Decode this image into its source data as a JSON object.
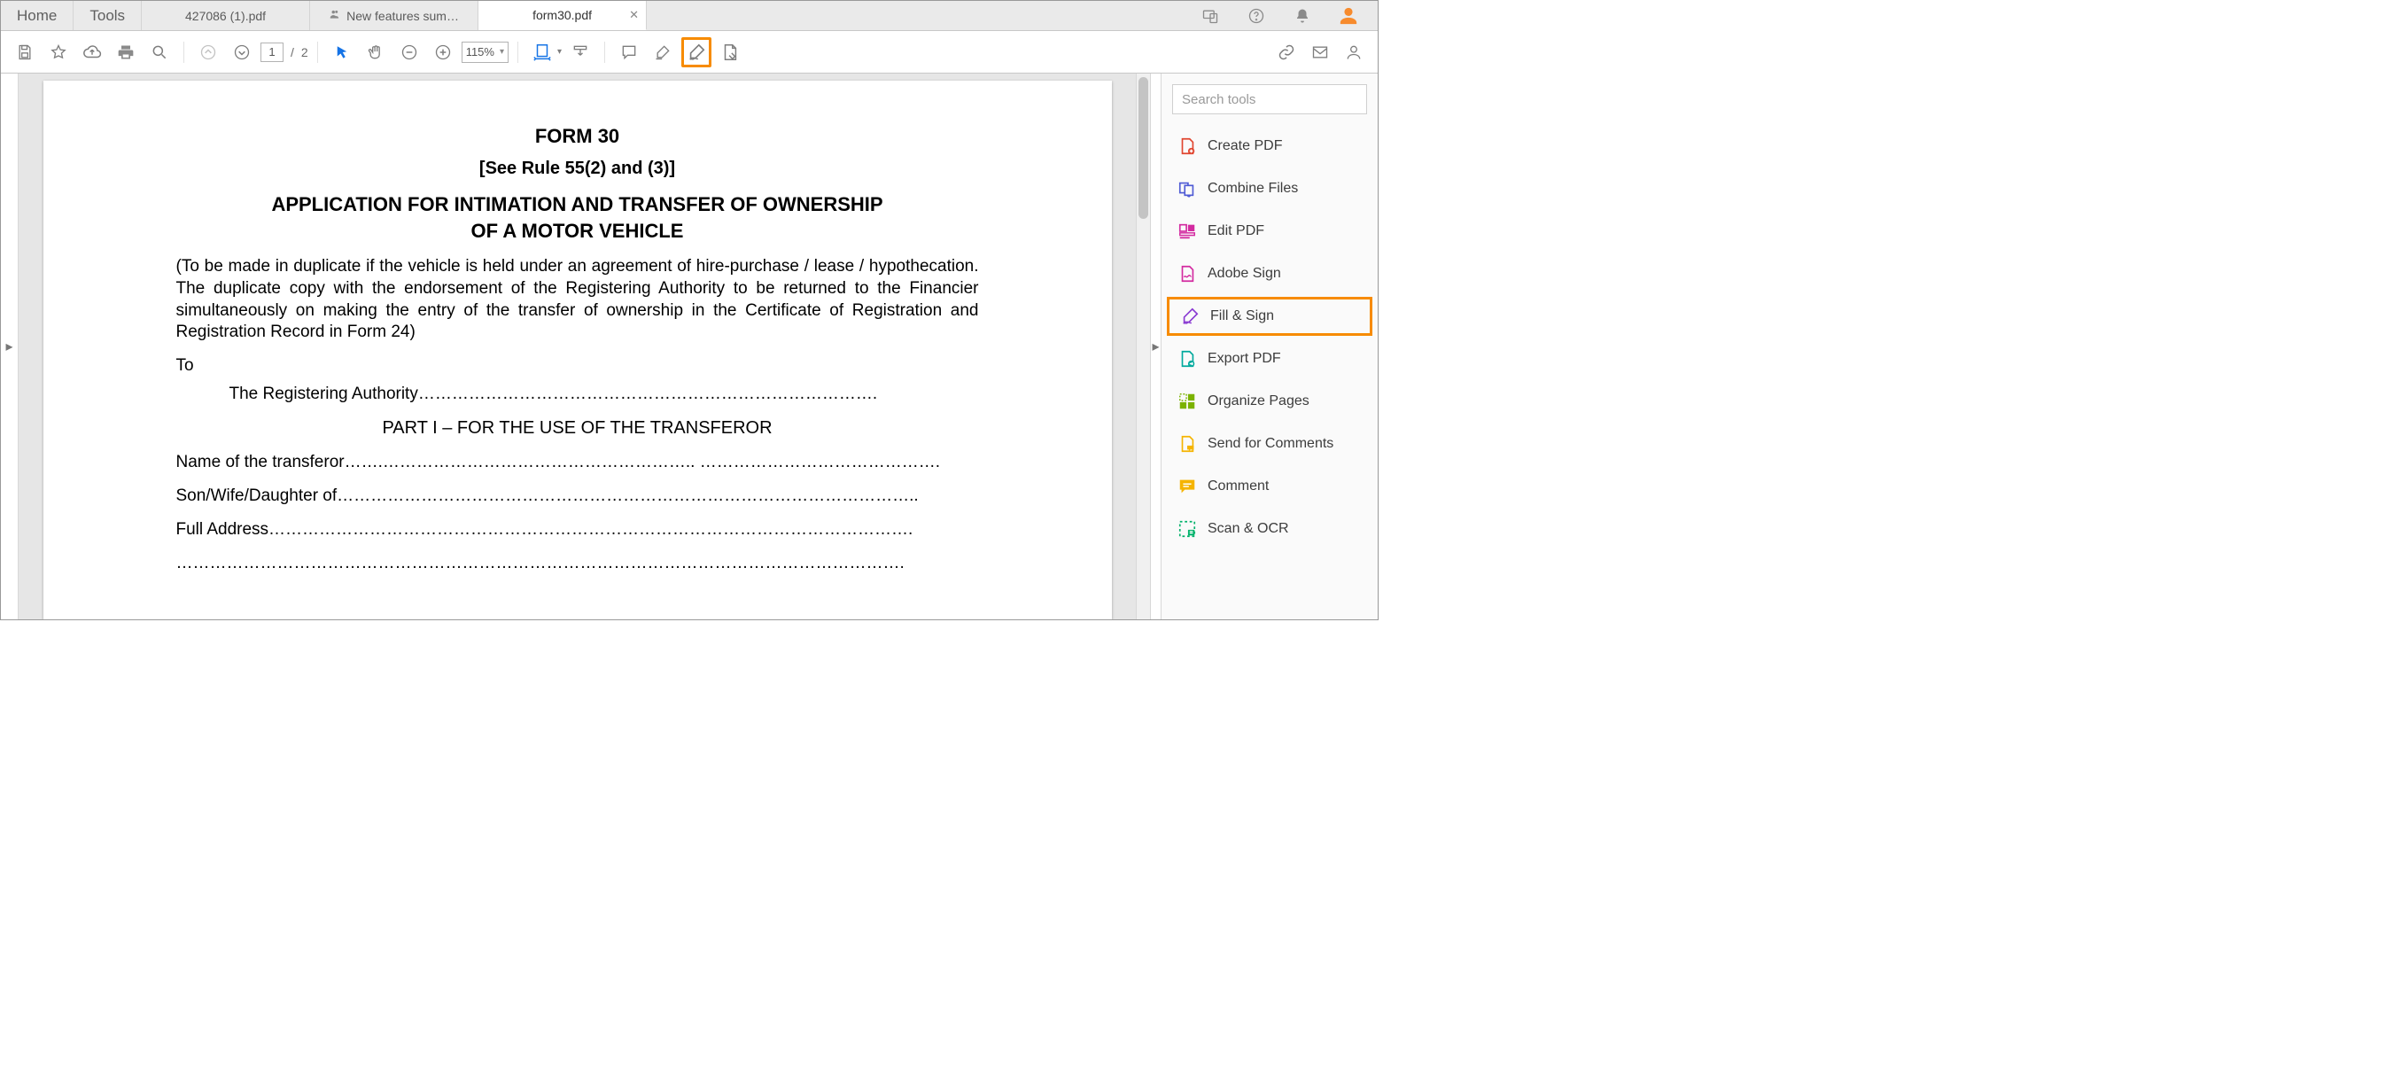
{
  "tabs": {
    "home": "Home",
    "tools": "Tools",
    "docs": [
      {
        "label": "427086 (1).pdf",
        "shared": false,
        "active": false
      },
      {
        "label": "New features sum…",
        "shared": true,
        "active": false
      },
      {
        "label": "form30.pdf",
        "shared": false,
        "active": true
      }
    ]
  },
  "toolbar": {
    "page_current": "1",
    "page_sep": "/",
    "page_total": "2",
    "zoom": "115%"
  },
  "document": {
    "title": "FORM 30",
    "subtitle": "[See Rule 55(2) and (3)]",
    "heading_l1": "APPLICATION FOR INTIMATION AND TRANSFER OF OWNERSHIP",
    "heading_l2": "OF A MOTOR VEHICLE",
    "note": "(To be made in duplicate if the vehicle is held under an agreement of hire-purchase / lease / hypothecation. The duplicate copy with the endorsement of the Registering Authority to be returned to the Financier simultaneously on making the entry of the transfer of ownership in the Certificate of Registration and Registration Record in Form 24)",
    "to": "To",
    "reg_auth": "The Registering Authority……………………………………………………………………….",
    "part": "PART I – FOR THE USE OF THE TRANSFEROR",
    "f1": "Name of the transferor…….……………………………………………….. …………………………………….",
    "f2": "Son/Wife/Daughter of…………………………………………………………………………………………..",
    "f3": "Full Address…………………………………………………………………………………………………….",
    "f4": "…………………………………………………………………………………………………………………."
  },
  "rpanel": {
    "search_placeholder": "Search tools",
    "tools": [
      {
        "label": "Create PDF",
        "color": "#e0452f"
      },
      {
        "label": "Combine Files",
        "color": "#4f5bd5"
      },
      {
        "label": "Edit PDF",
        "color": "#d32aa0"
      },
      {
        "label": "Adobe Sign",
        "color": "#d32aa0"
      },
      {
        "label": "Fill & Sign",
        "color": "#8a3bd2",
        "highlight": true
      },
      {
        "label": "Export PDF",
        "color": "#00a99d"
      },
      {
        "label": "Organize Pages",
        "color": "#7bb200"
      },
      {
        "label": "Send for Comments",
        "color": "#f5b400"
      },
      {
        "label": "Comment",
        "color": "#f5b400"
      },
      {
        "label": "Scan & OCR",
        "color": "#00b26a"
      }
    ]
  }
}
